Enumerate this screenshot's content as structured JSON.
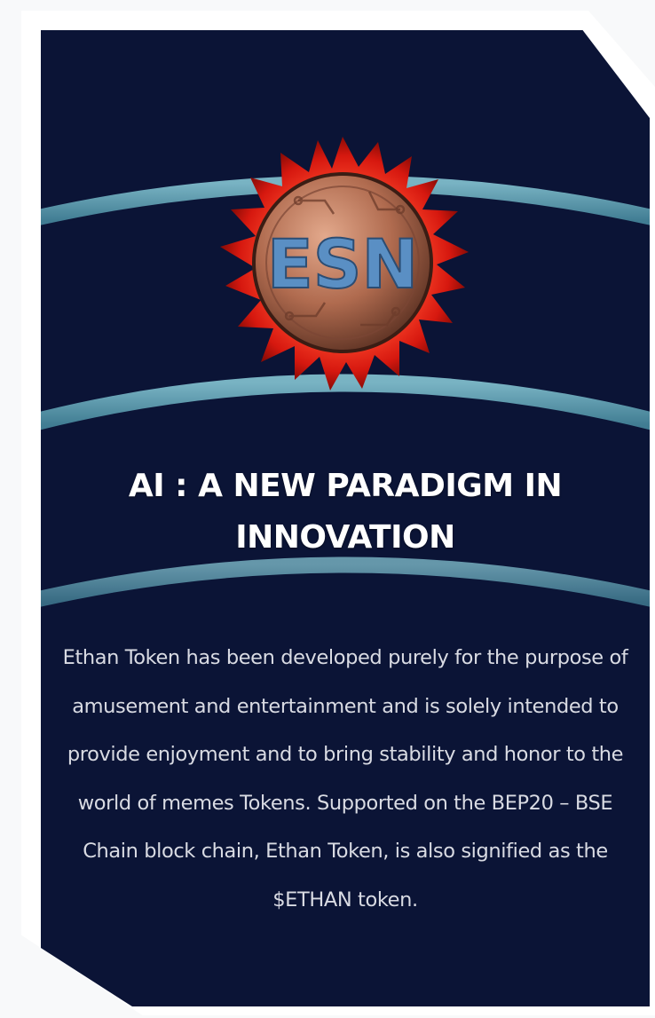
{
  "card": {
    "title": "AI : A NEW PARADIGM IN INNOVATION",
    "body": "Ethan Token has been developed purely for the purpose of amusement and entertainment and is solely intended to provide enjoyment and to bring stability and honor to the world of memes Tokens. Supported on the BEP20 – BSE Chain block chain, Ethan Token, is also signified as the $ETHAN token.",
    "logo_letters": "ESN",
    "colors": {
      "background": "#0b1436",
      "arc": "#6bb3c4",
      "splash": "#e0261c",
      "coin": "#b06b4f",
      "title": "#ffffff",
      "body": "#d9dbe3"
    }
  }
}
